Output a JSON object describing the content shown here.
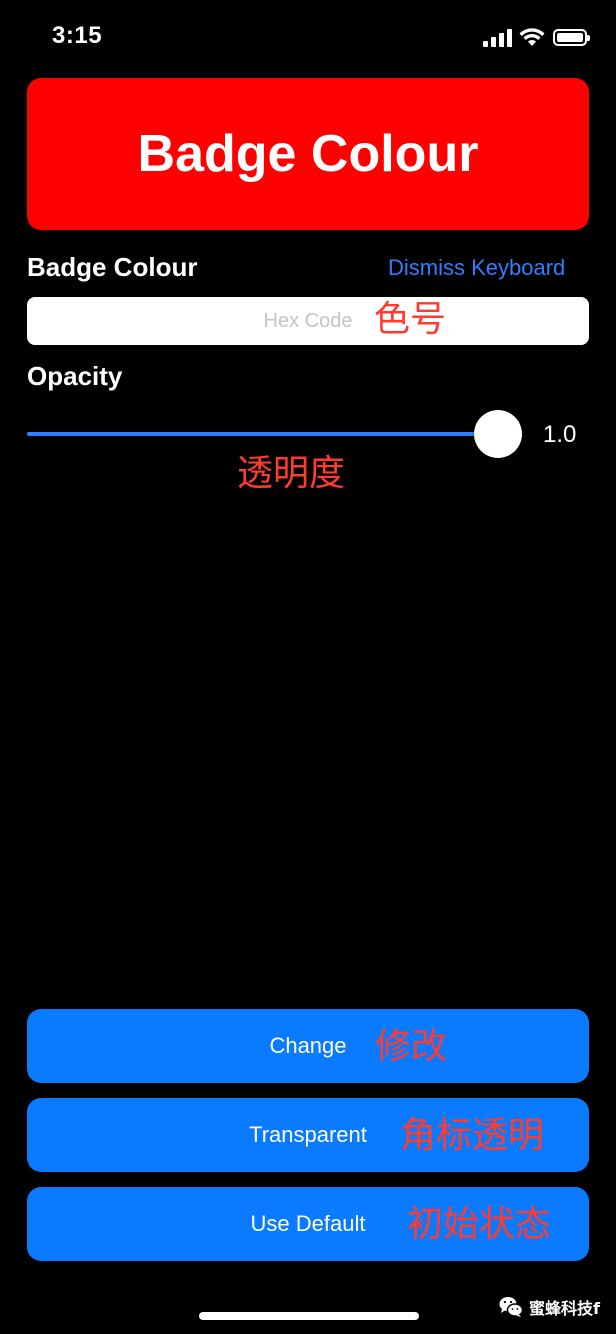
{
  "status_bar": {
    "time": "3:15"
  },
  "preview": {
    "title": "Badge Colour",
    "color": "#ff0000"
  },
  "colour_section": {
    "label": "Badge Colour",
    "dismiss_label": "Dismiss Keyboard",
    "hex_placeholder": "Hex Code",
    "hex_value": "",
    "annotation": "色号"
  },
  "opacity_section": {
    "label": "Opacity",
    "value_text": "1.0",
    "value": 1.0,
    "annotation": "透明度"
  },
  "buttons": [
    {
      "label": "Change",
      "annotation": "修改"
    },
    {
      "label": "Transparent",
      "annotation": "角标透明"
    },
    {
      "label": "Use Default",
      "annotation": "初始状态"
    }
  ],
  "watermark": {
    "text": "蜜蜂科技f"
  },
  "colors": {
    "accent": "#0a7aff",
    "link": "#2f7fff",
    "annotation": "#ff3b30",
    "background": "#000000"
  }
}
